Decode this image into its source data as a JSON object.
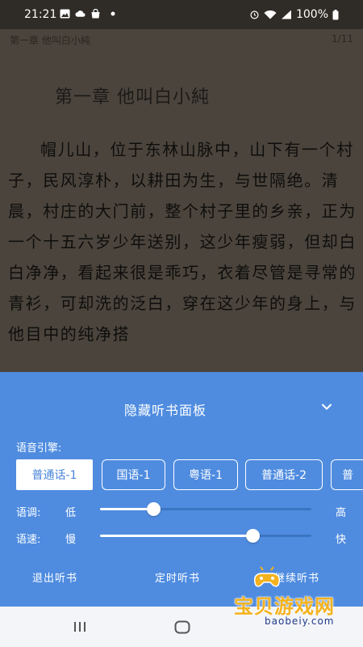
{
  "status_bar": {
    "time": "21:21",
    "battery": "100%",
    "left_icons": [
      "image-icon",
      "cloud-icon",
      "bag-icon",
      "dot-icon"
    ],
    "right_icons": [
      "alarm-icon",
      "wifi-icon",
      "signal-icon",
      "battery-icon"
    ]
  },
  "reader": {
    "header_chapter": "第一章 他叫白小純",
    "page_indicator": "1/11",
    "chapter_title": "第一章  他叫白小純",
    "body_text": "帽儿山，位于东林山脉中，山下有一个村子，民风淳朴，以耕田为生，与世隔绝。清晨，村庄的大门前，整个村子里的乡亲，正为一个十五六岁少年送别，这少年瘦弱，但却白白净净，看起来很是乖巧，衣着尽管是寻常的青衫，可却洗的泛白，穿在这少年的身上，与他目中的纯净搭"
  },
  "tts_panel": {
    "title": "隐藏听书面板",
    "engine_label": "语音引擎:",
    "engines": [
      {
        "label": "普通话-1",
        "selected": true
      },
      {
        "label": "国语-1",
        "selected": false
      },
      {
        "label": "粤语-1",
        "selected": false
      },
      {
        "label": "普通话-2",
        "selected": false
      },
      {
        "label": "普",
        "selected": false
      }
    ],
    "pitch": {
      "label": "语调:",
      "min_label": "低",
      "max_label": "高",
      "value": 0.25
    },
    "speed": {
      "label": "语速:",
      "min_label": "慢",
      "max_label": "快",
      "value": 0.72
    },
    "actions": {
      "exit": "退出听书",
      "timer": "定时听书",
      "continue": "继续听书"
    }
  },
  "watermark": {
    "text": "宝贝游戏网",
    "url": "baobeiy.com"
  },
  "colors": {
    "panel_bg": "#4f8ce0",
    "reader_bg": "#4a443c",
    "status_bg": "#2f2b26",
    "nav_bg": "#f4f5f8"
  }
}
